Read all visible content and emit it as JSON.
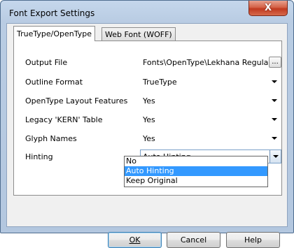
{
  "window": {
    "title": "Font Export Settings",
    "close_glyph": "X"
  },
  "tabs": [
    {
      "label": "TrueType/OpenType",
      "active": true
    },
    {
      "label": "Web Font (WOFF)",
      "active": false
    }
  ],
  "fields": {
    "output_file": {
      "label": "Output File",
      "value": "Fonts\\OpenType\\Lekhana Regular.otf",
      "browse_label": "..."
    },
    "outline_format": {
      "label": "Outline Format",
      "value": "TrueType"
    },
    "layout_features": {
      "label": "OpenType Layout Features",
      "value": "Yes"
    },
    "kern_table": {
      "label": "Legacy 'KERN' Table",
      "value": "Yes"
    },
    "glyph_names": {
      "label": "Glyph Names",
      "value": "Yes"
    },
    "hinting": {
      "label": "Hinting",
      "value": "Auto Hinting"
    }
  },
  "hinting_options": [
    "No",
    "Auto Hinting",
    "Keep Original"
  ],
  "hinting_selected_index": 1,
  "buttons": {
    "ok": "OK",
    "cancel": "Cancel",
    "help": "Help"
  },
  "colors": {
    "selection": "#3399ff",
    "close_button": "#c0391f"
  }
}
